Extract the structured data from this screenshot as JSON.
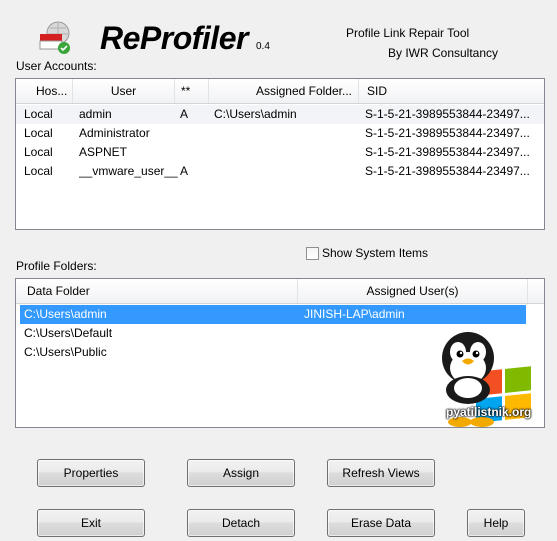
{
  "header": {
    "title": "ReProfiler",
    "version": "0.4",
    "tagline": "Profile Link Repair Tool",
    "byline": "By IWR Consultancy"
  },
  "user_accounts": {
    "label": "User Accounts:",
    "columns": [
      "Hos...",
      "User",
      "**",
      "Assigned Folder...",
      "SID"
    ],
    "rows": [
      {
        "host": "Local",
        "user": "admin",
        "flag": "A",
        "folder": "C:\\Users\\admin",
        "sid": "S-1-5-21-3989553844-23497..."
      },
      {
        "host": "Local",
        "user": "Administrator",
        "flag": "",
        "folder": "",
        "sid": "S-1-5-21-3989553844-23497..."
      },
      {
        "host": "Local",
        "user": "ASPNET",
        "flag": "",
        "folder": "",
        "sid": "S-1-5-21-3989553844-23497..."
      },
      {
        "host": "Local",
        "user": "__vmware_user__",
        "flag": "A",
        "folder": "",
        "sid": "S-1-5-21-3989553844-23497..."
      }
    ]
  },
  "profile_folders": {
    "label": "Profile Folders:",
    "show_system_items": {
      "label": "Show System Items",
      "checked": false
    },
    "columns": [
      "Data Folder",
      "Assigned User(s)"
    ],
    "rows": [
      {
        "folder": "C:\\Users\\admin",
        "users": "JINISH-LAP\\admin",
        "selected": true
      },
      {
        "folder": "C:\\Users\\Default",
        "users": "",
        "selected": false
      },
      {
        "folder": "C:\\Users\\Public",
        "users": "",
        "selected": false
      }
    ]
  },
  "watermark": {
    "text": "pyatilistnik.org"
  },
  "buttons": {
    "properties": "Properties",
    "assign": "Assign",
    "refresh": "Refresh Views",
    "exit": "Exit",
    "detach": "Detach",
    "erase": "Erase Data",
    "help": "Help"
  },
  "colors": {
    "selection": "#3399ff",
    "window_bg": "#f0f0f0"
  }
}
